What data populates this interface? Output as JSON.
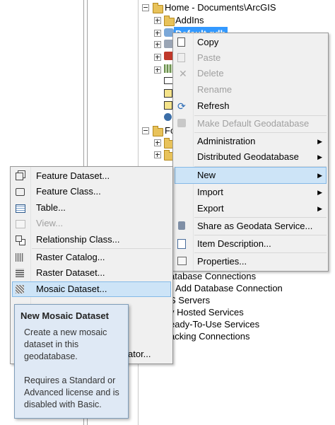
{
  "tree": {
    "root": "Home - Documents\\ArcGIS",
    "addins": "AddIns",
    "selected": "Default.gdb",
    "folder_partial": "Fo",
    "below_items": [
      "atabase Connections",
      "Add Database Connection",
      "S Servers",
      "y Hosted Services",
      "eady-To-Use Services",
      "acking Connections"
    ]
  },
  "context_menu": {
    "items": [
      {
        "label": "Copy",
        "icon": "copy-icon",
        "enabled": true
      },
      {
        "label": "Paste",
        "icon": "paste-icon",
        "enabled": false
      },
      {
        "label": "Delete",
        "icon": "delete-icon",
        "enabled": false
      },
      {
        "label": "Rename",
        "icon": "",
        "enabled": false
      },
      {
        "label": "Refresh",
        "icon": "refresh-icon",
        "enabled": true
      },
      {
        "label": "Make Default Geodatabase",
        "icon": "geodatabase-icon",
        "enabled": false
      },
      {
        "label": "Administration",
        "submenu": true,
        "enabled": true
      },
      {
        "label": "Distributed Geodatabase",
        "submenu": true,
        "enabled": true
      },
      {
        "label": "New",
        "submenu": true,
        "enabled": true,
        "highlighted": true
      },
      {
        "label": "Import",
        "submenu": true,
        "enabled": true
      },
      {
        "label": "Export",
        "submenu": true,
        "enabled": true
      },
      {
        "label": "Share as Geodata Service...",
        "icon": "share-service-icon",
        "enabled": true
      },
      {
        "label": "Item Description...",
        "icon": "item-description-icon",
        "enabled": true
      },
      {
        "label": "Properties...",
        "icon": "properties-icon",
        "enabled": true
      }
    ]
  },
  "new_submenu": {
    "items": [
      {
        "label": "Feature Dataset...",
        "icon": "feature-dataset-icon",
        "enabled": true
      },
      {
        "label": "Feature Class...",
        "icon": "feature-class-icon",
        "enabled": true
      },
      {
        "label": "Table...",
        "icon": "table-icon",
        "enabled": true
      },
      {
        "label": "View...",
        "icon": "view-icon",
        "enabled": false
      },
      {
        "label": "Relationship Class...",
        "icon": "relationship-class-icon",
        "enabled": true
      },
      {
        "label": "Raster Catalog...",
        "icon": "raster-catalog-icon",
        "enabled": true
      },
      {
        "label": "Raster Dataset...",
        "icon": "raster-dataset-icon",
        "enabled": true
      },
      {
        "label": "Mosaic Dataset...",
        "icon": "mosaic-dataset-icon",
        "enabled": true,
        "highlighted": true
      },
      {
        "label": "ator...",
        "icon": "",
        "enabled": true
      }
    ]
  },
  "tooltip": {
    "title": "New Mosaic Dataset",
    "description": "Create a new mosaic dataset in this geodatabase.",
    "license_note": "Requires a Standard or Advanced license and is disabled with Basic."
  }
}
